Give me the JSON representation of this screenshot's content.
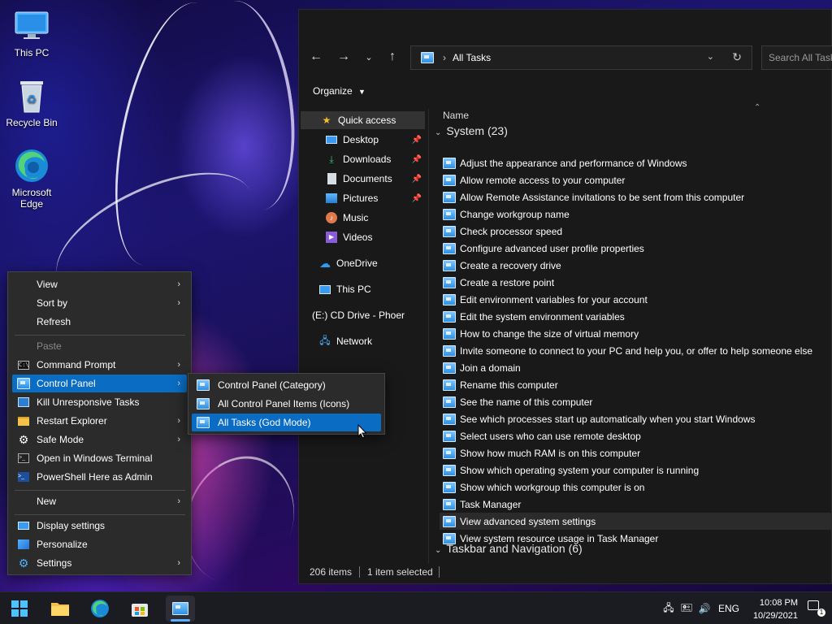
{
  "desktop": {
    "icons": [
      {
        "label": "This PC",
        "icon": "this-pc-icon"
      },
      {
        "label": "Recycle Bin",
        "icon": "recycle-bin-icon"
      },
      {
        "label": "Microsoft Edge",
        "icon": "edge-icon"
      }
    ]
  },
  "explorer": {
    "address_path": "All Tasks",
    "search_placeholder": "Search All Tasks",
    "toolbar_organize": "Organize",
    "nav": [
      {
        "label": "Quick access",
        "icon": "star-icon",
        "pinned": false
      },
      {
        "label": "Desktop",
        "icon": "desktop-folder-icon",
        "pinned": true
      },
      {
        "label": "Downloads",
        "icon": "download-icon",
        "pinned": true
      },
      {
        "label": "Documents",
        "icon": "documents-icon",
        "pinned": true
      },
      {
        "label": "Pictures",
        "icon": "pictures-icon",
        "pinned": true
      },
      {
        "label": "Music",
        "icon": "music-icon",
        "pinned": false
      },
      {
        "label": "Videos",
        "icon": "videos-icon",
        "pinned": false
      },
      {
        "label": "OneDrive",
        "icon": "onedrive-icon",
        "pinned": false
      },
      {
        "label": "This PC",
        "icon": "this-pc-icon",
        "pinned": false
      },
      {
        "label": "(E:) CD Drive - Phoer",
        "icon": "cd-drive-icon",
        "pinned": false
      },
      {
        "label": "Network",
        "icon": "network-icon",
        "pinned": false
      }
    ],
    "column_header": "Name",
    "group_system": "System (23)",
    "group_next": "Taskbar and Navigation (6)",
    "items": [
      "Adjust the appearance and performance of Windows",
      "Allow remote access to your computer",
      "Allow Remote Assistance invitations to be sent from this computer",
      "Change workgroup name",
      "Check processor speed",
      "Configure advanced user profile properties",
      "Create a recovery drive",
      "Create a restore point",
      "Edit environment variables for your account",
      "Edit the system environment variables",
      "How to change the size of virtual memory",
      "Invite someone to connect to your PC and help you, or offer to help someone else",
      "Join a domain",
      "Rename this computer",
      "See the name of this computer",
      "See which processes start up automatically when you start Windows",
      "Select users who can use remote desktop",
      "Show how much RAM is on this computer",
      "Show which operating system your computer is running",
      "Show which workgroup this computer is on",
      "Task Manager",
      "View advanced system settings",
      "View system resource usage in Task Manager"
    ],
    "highlighted_item": "View advanced system settings",
    "status_count": "206 items",
    "status_selected": "1 item selected"
  },
  "context_menu": {
    "view": "View",
    "sort_by": "Sort by",
    "refresh": "Refresh",
    "paste": "Paste",
    "command_prompt": "Command Prompt",
    "control_panel": "Control Panel",
    "kill_tasks": "Kill Unresponsive Tasks",
    "restart_explorer": "Restart Explorer",
    "safe_mode": "Safe Mode",
    "windows_terminal": "Open in Windows Terminal",
    "powershell_admin": "PowerShell Here as Admin",
    "new": "New",
    "display_settings": "Display settings",
    "personalize": "Personalize",
    "settings": "Settings"
  },
  "submenu": {
    "category": "Control Panel (Category)",
    "all_items": "All Control Panel Items (Icons)",
    "all_tasks": "All Tasks (God Mode)"
  },
  "taskbar": {
    "language": "ENG",
    "time": "10:08 PM",
    "date": "10/29/2021",
    "notification_count": "1"
  },
  "colors": {
    "accent": "#0a6cc2",
    "explorer_bg": "#191919",
    "menu_bg": "#2b2b2b"
  }
}
